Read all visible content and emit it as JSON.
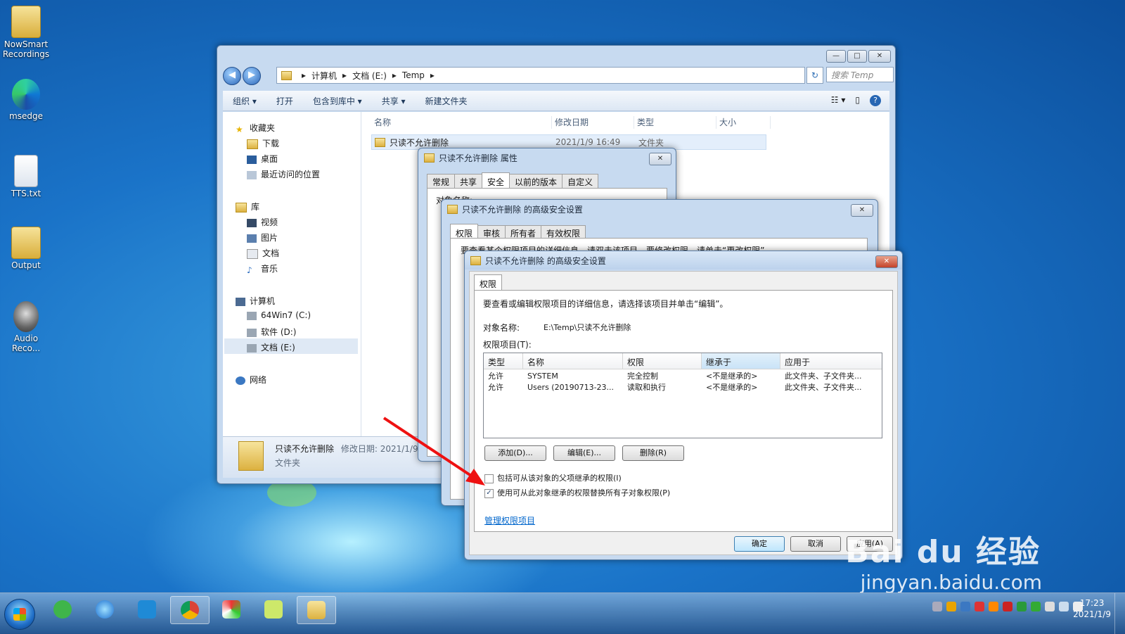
{
  "desktop": {
    "icons": [
      {
        "label": "NowSmart Recordings"
      },
      {
        "label": "msedge"
      },
      {
        "label": "TTS.txt"
      },
      {
        "label": "Output"
      },
      {
        "label": "Audio Reco..."
      }
    ]
  },
  "explorer": {
    "breadcrumb": [
      "计算机",
      "文档 (E:)",
      "Temp"
    ],
    "search_placeholder": "搜索 Temp",
    "toolbar": [
      "组织 ▾",
      "打开",
      "包含到库中 ▾",
      "共享 ▾",
      "新建文件夹"
    ],
    "nav": {
      "favorites": "收藏夹",
      "fav_items": [
        "下载",
        "桌面",
        "最近访问的位置"
      ],
      "library": "库",
      "lib_items": [
        "视频",
        "图片",
        "文档",
        "音乐"
      ],
      "computer": "计算机",
      "drives": [
        "64Win7 (C:)",
        "软件 (D:)",
        "文档 (E:)"
      ],
      "network": "网络"
    },
    "columns": [
      "名称",
      "修改日期",
      "类型",
      "大小"
    ],
    "file": {
      "name": "只读不允许删除",
      "date": "2021/1/9 16:49",
      "type": "文件夹"
    },
    "details": {
      "name": "只读不允许删除",
      "meta": "修改日期: 2021/1/9",
      "type": "文件夹"
    }
  },
  "props_dialog": {
    "title": "只读不允许删除 属性",
    "tabs": [
      "常规",
      "共享",
      "安全",
      "以前的版本",
      "自定义"
    ],
    "object_prefix": "对象名称:"
  },
  "adv_back": {
    "title": "只读不允许删除 的高级安全设置",
    "tabs": [
      "权限",
      "审核",
      "所有者",
      "有效权限"
    ],
    "info": "要查看某个权限项目的详细信息，请双击该项目。要修改权限，请单击“更改权限”。"
  },
  "adv_front": {
    "title": "只读不允许删除 的高级安全设置",
    "tab": "权限",
    "info": "要查看或编辑权限项目的详细信息，请选择该项目并单击“编辑”。",
    "object_label": "对象名称:",
    "object_value": "E:\\Temp\\只读不允许删除",
    "entries_label": "权限项目(T):",
    "columns": [
      "类型",
      "名称",
      "权限",
      "继承于",
      "应用于"
    ],
    "rows": [
      [
        "允许",
        "SYSTEM",
        "完全控制",
        "<不是继承的>",
        "此文件夹、子文件夹..."
      ],
      [
        "允许",
        "Users (20190713-23...",
        "读取和执行",
        "<不是继承的>",
        "此文件夹、子文件夹..."
      ]
    ],
    "btn_add": "添加(D)...",
    "btn_edit": "编辑(E)...",
    "btn_delete": "删除(R)",
    "cb_include": "包括可从该对象的父项继承的权限(I)",
    "cb_replace": "使用可从此对象继承的权限替换所有子对象权限(P)",
    "manage_link": "管理权限项目",
    "ok": "确定",
    "cancel": "取消",
    "apply": "应用(A)"
  },
  "taskbar": {
    "time": "17:23",
    "date": "2021/1/9"
  },
  "watermark": {
    "logo": "Bai du 经验",
    "url": "jingyan.baidu.com"
  }
}
